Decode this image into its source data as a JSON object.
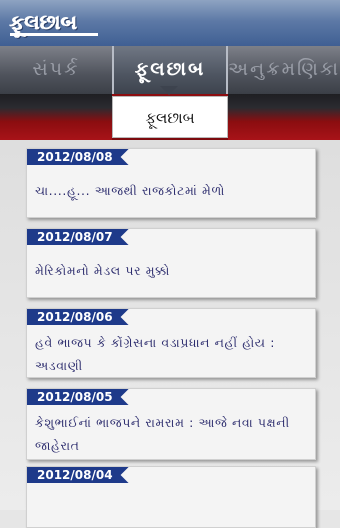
{
  "app": {
    "logo_text": "ફૂલછાબ"
  },
  "tabs": {
    "left_label": "સંપર્ક",
    "active_label": "ફૂલછાબ",
    "right_label": "અનુક્રમણિકા"
  },
  "section": {
    "label": "ફૂલછાબ"
  },
  "news": [
    {
      "date": "2012/08/08",
      "title": "ચા....હૂ... આજથી રાજકોટમાં મેળો"
    },
    {
      "date": "2012/08/07",
      "title": "મેરિકોમનો મેડલ પર મુક્કો"
    },
    {
      "date": "2012/08/06",
      "title": "હવે ભાજપ કે કોંગ્રેસના વડાપ્રધાન નહીં હોય : અડવાણી"
    },
    {
      "date": "2012/08/05",
      "title": "કેશુભાઈનાં ભાજપને રામરામ : આજે નવા પક્ષની જાહેરાત"
    },
    {
      "date": "2012/08/04",
      "title": ""
    }
  ],
  "colors": {
    "topbar": "#5d79a6",
    "tab_bar": "#4f535c",
    "banner_red": "#b4161b",
    "date_tag": "#1e3a8a",
    "headline_text": "#2d2d6e"
  }
}
